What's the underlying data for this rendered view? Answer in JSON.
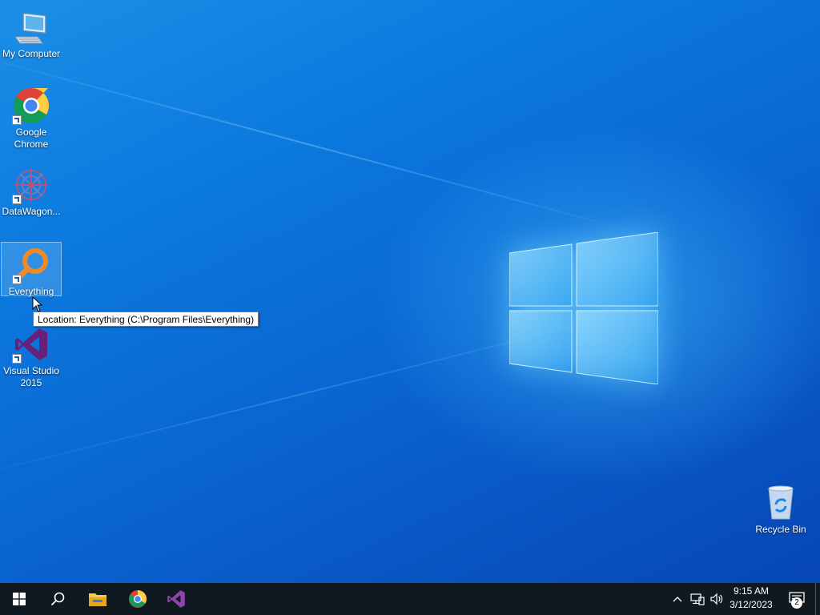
{
  "desktop": {
    "icons": [
      {
        "label": "My Computer",
        "icon": "computer-icon"
      },
      {
        "label": "Google\nChrome",
        "icon": "chrome-icon"
      },
      {
        "label": "DataWagon...",
        "icon": "datawagon-icon"
      },
      {
        "label": "Everything",
        "icon": "everything-search-icon"
      },
      {
        "label": "Visual Studio\n2015",
        "icon": "visual-studio-icon"
      },
      {
        "label": "Recycle Bin",
        "icon": "recycle-bin-icon"
      }
    ],
    "tooltip": "Location: Everything (C:\\Program Files\\Everything)"
  },
  "taskbar": {
    "start_icon": "windows-start-icon",
    "search_icon": "search-icon",
    "pinned": [
      "file-explorer-icon",
      "chrome-icon",
      "visual-studio-icon"
    ],
    "tray": {
      "chevron_icon": "chevron-up-icon",
      "network_icon": "network-icon",
      "volume_icon": "volume-icon",
      "time": "9:15 AM",
      "date": "3/12/2023",
      "notification_count": "2"
    }
  },
  "colors": {
    "desktop_accent": "#0a63c9",
    "taskbar": "#101820",
    "vs_purple": "#68217a",
    "everything_orange": "#f08a24"
  }
}
